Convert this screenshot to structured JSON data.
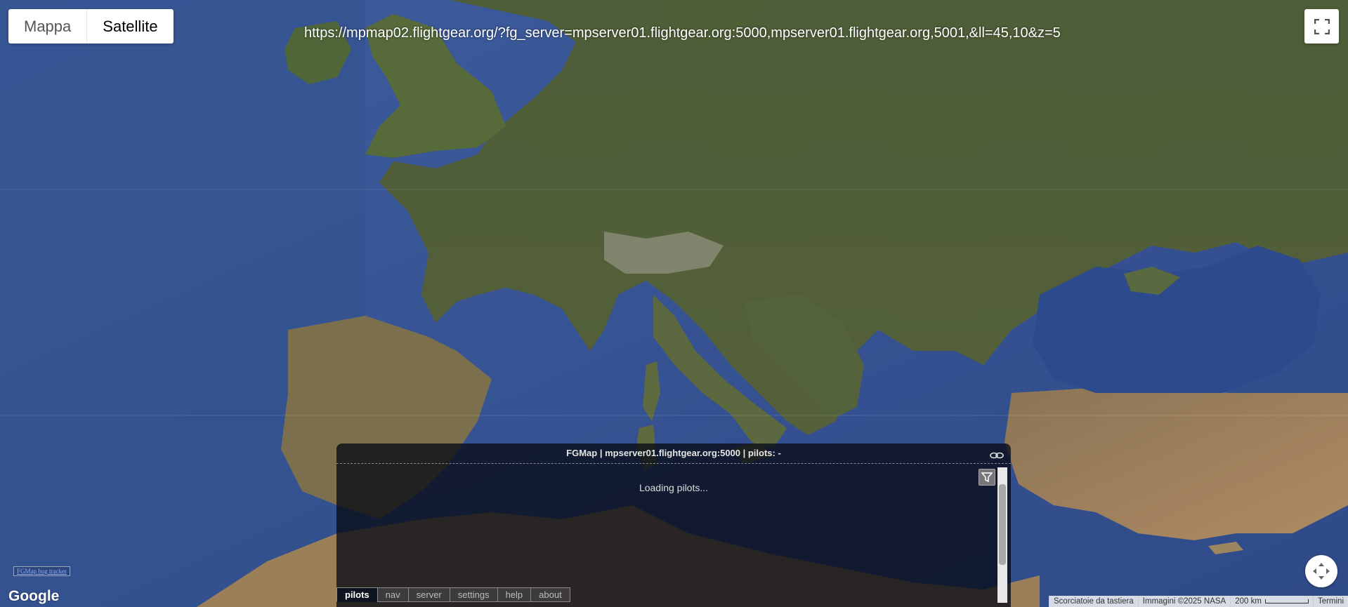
{
  "map_type_control": {
    "options": [
      {
        "label": "Mappa",
        "selected": false
      },
      {
        "label": "Satellite",
        "selected": true
      }
    ]
  },
  "url_overlay": "https://mpmap02.flightgear.org/?fg_server=mpserver01.flightgear.org:5000,mpserver01.flightgear.org,5001,&ll=45,10&z=5",
  "bug_tracker_link": "FGMap bug tracker",
  "google_logo": "Google",
  "panel": {
    "title": "FGMap | mpserver01.flightgear.org:5000 | pilots: -",
    "loading": "Loading pilots...",
    "tabs": [
      {
        "label": "pilots",
        "active": true
      },
      {
        "label": "nav",
        "active": false
      },
      {
        "label": "server",
        "active": false
      },
      {
        "label": "settings",
        "active": false
      },
      {
        "label": "help",
        "active": false
      },
      {
        "label": "about",
        "active": false
      }
    ]
  },
  "attribution": {
    "shortcuts": "Scorciatoie da tastiera",
    "imagery": "Immagini ©2025 NASA",
    "scale": "200 km",
    "terms": "Termini"
  },
  "icons": {
    "fullscreen": "fullscreen-icon",
    "link": "link-icon",
    "filter": "filter-icon",
    "camera_control": "camera-control-icon"
  },
  "colors": {
    "sea": "#3a5596",
    "land": "#4a5a34",
    "panel_bg": "#0b0f1a"
  }
}
